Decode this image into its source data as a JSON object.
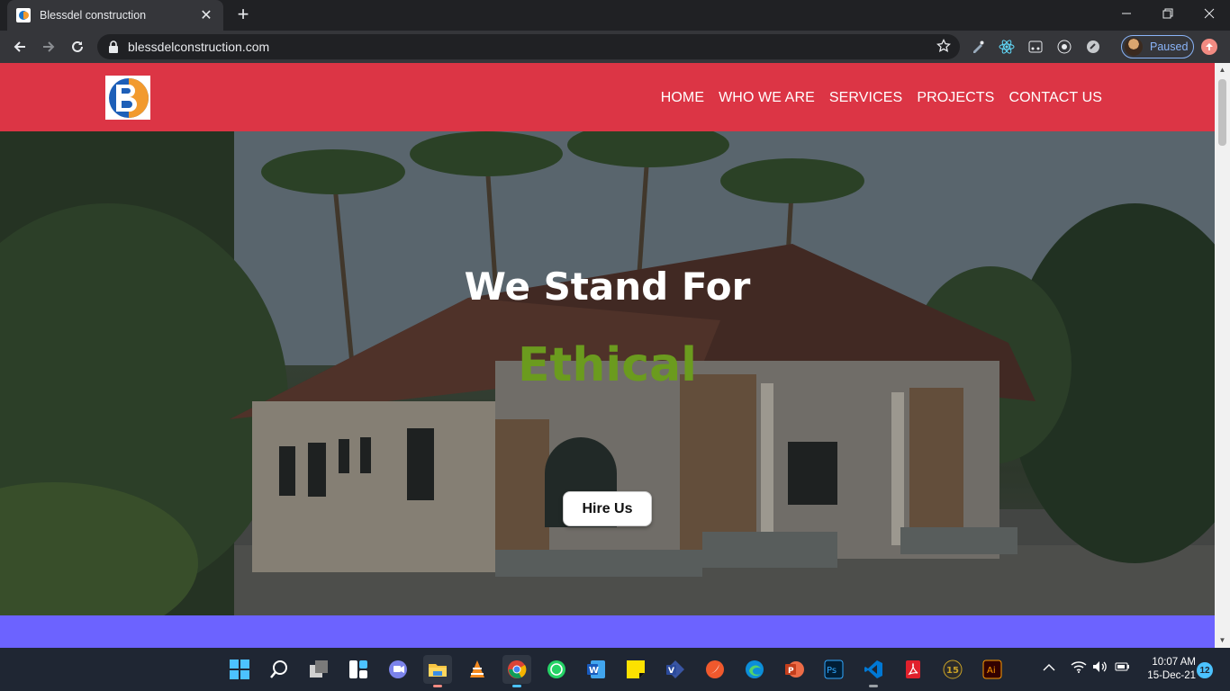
{
  "browser": {
    "tab": {
      "title": "Blessdel construction"
    },
    "new_tab_symbol": "+",
    "url": "blessdelconstruction.com",
    "profile": {
      "label": "Paused"
    },
    "window_controls": [
      "minimize",
      "restore",
      "close"
    ]
  },
  "site": {
    "nav": {
      "items": [
        "HOME",
        "WHO WE ARE",
        "SERVICES",
        "PROJECTS",
        "CONTACT US"
      ]
    },
    "hero": {
      "heading": "We Stand For",
      "word": "Ethical",
      "button": "Hire Us"
    },
    "colors": {
      "header": "#dc3545",
      "band": "#6c63ff",
      "accent_word": "#6b9b1e"
    }
  },
  "taskbar": {
    "apps": [
      "windows-start",
      "search",
      "task-view",
      "widgets",
      "teams-chat",
      "file-explorer",
      "vlc",
      "chrome",
      "whatsapp",
      "word",
      "sticky-notes",
      "visio",
      "swift-playgrounds",
      "edge",
      "powerpoint",
      "photoshop",
      "vscode",
      "acrobat",
      "app-15",
      "illustrator"
    ],
    "time": "10:07 AM",
    "date": "15-Dec-21",
    "notification_count": "12"
  }
}
